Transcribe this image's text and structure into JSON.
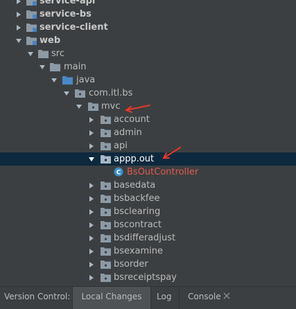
{
  "tree": {
    "items": [
      {
        "label": "service-api"
      },
      {
        "label": "service-bs"
      },
      {
        "label": "service-client"
      },
      {
        "label": "web"
      },
      {
        "label": "src"
      },
      {
        "label": "main"
      },
      {
        "label": "java"
      },
      {
        "label": "com.itl.bs"
      },
      {
        "label": "mvc"
      },
      {
        "label": "account"
      },
      {
        "label": "admin"
      },
      {
        "label": "api"
      },
      {
        "label": "appp.out"
      },
      {
        "label": "BsOutController"
      },
      {
        "label": "basedata"
      },
      {
        "label": "bsbackfee"
      },
      {
        "label": "bsclearing"
      },
      {
        "label": "bscontract"
      },
      {
        "label": "bsdifferadjust"
      },
      {
        "label": "bsexamine"
      },
      {
        "label": "bsorder"
      },
      {
        "label": "bsreceiptspay"
      }
    ]
  },
  "toolbar": {
    "version_control_label": "Version Control:",
    "tabs": [
      {
        "label": "Local Changes",
        "active": true
      },
      {
        "label": "Log",
        "active": false
      },
      {
        "label": "Console",
        "active": false
      }
    ]
  },
  "colors": {
    "background": "#3c3f41",
    "selection": "#0d293e",
    "folder": "#8c9aa6",
    "module_folder": "#4a82bf",
    "java_folder": "#4a89c8",
    "error_text": "#e05a4e",
    "annotation_arrow": "#e8382a"
  }
}
